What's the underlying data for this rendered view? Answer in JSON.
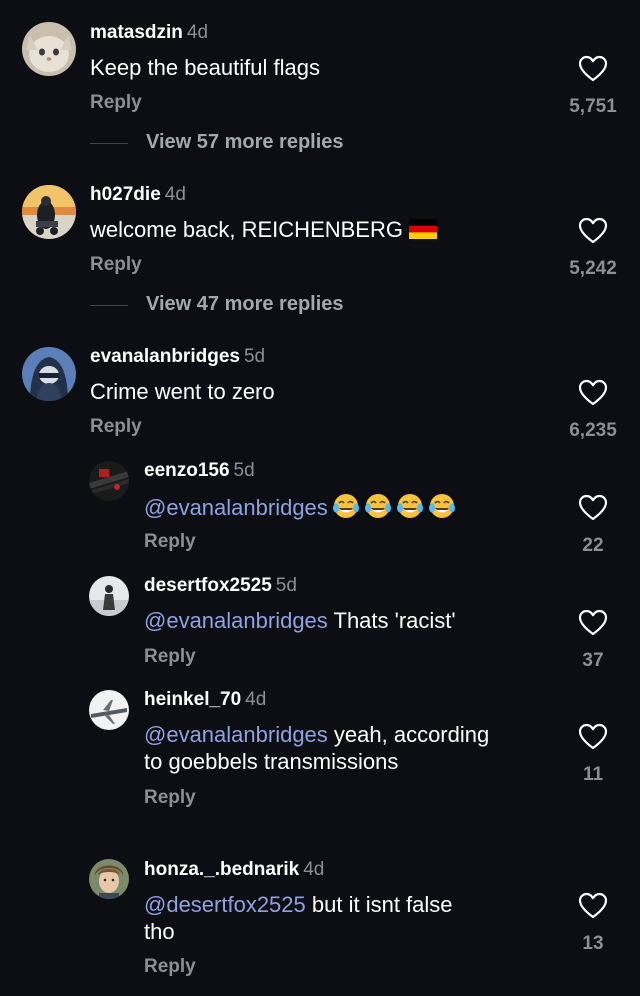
{
  "comments": [
    {
      "username": "matasdzin",
      "age": "4d",
      "text": "Keep the beautiful flags",
      "reply_label": "Reply",
      "likes": "5,751",
      "view_more": "View 57 more replies"
    },
    {
      "username": "h027die",
      "age": "4d",
      "text": "welcome back, REICHENBERG",
      "reply_label": "Reply",
      "likes": "5,242",
      "view_more": "View 47 more replies"
    },
    {
      "username": "evanalanbridges",
      "age": "5d",
      "text": "Crime went to zero",
      "reply_label": "Reply",
      "likes": "6,235"
    }
  ],
  "replies": [
    {
      "username": "eenzo156",
      "age": "5d",
      "mention": "@evanalanbridges",
      "text": "",
      "reply_label": "Reply",
      "likes": "22"
    },
    {
      "username": "desertfox2525",
      "age": "5d",
      "mention": "@evanalanbridges",
      "text": " Thats 'racist'",
      "reply_label": "Reply",
      "likes": "37"
    },
    {
      "username": "heinkel_70",
      "age": "4d",
      "mention": "@evanalanbridges",
      "text": " yeah, according",
      "text_line2": "to goebbels transmissions",
      "reply_label": "Reply",
      "likes": "11"
    },
    {
      "username": "honza._.bednarik",
      "age": "4d",
      "mention": "@desertfox2525",
      "text": " but it isnt false",
      "text_line2": "tho",
      "reply_label": "Reply",
      "likes": "13"
    }
  ],
  "icons": {
    "like": "heart-outline-icon",
    "emoji": "face-with-tears-of-joy-emoji",
    "flag": "germany-flag-emoji"
  },
  "colors": {
    "background": "#0c0e14",
    "mention": "#8fa3e0",
    "secondary_text": "#8a8f98"
  }
}
